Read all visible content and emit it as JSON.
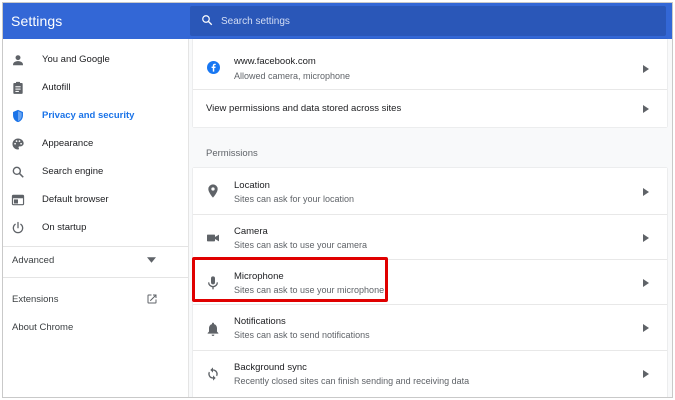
{
  "header": {
    "title": "Settings",
    "search_placeholder": "Search settings"
  },
  "sidebar": {
    "items": [
      {
        "label": "You and Google",
        "icon": "person-icon"
      },
      {
        "label": "Autofill",
        "icon": "clipboard-icon"
      },
      {
        "label": "Privacy and security",
        "icon": "shield-icon",
        "active": true
      },
      {
        "label": "Appearance",
        "icon": "palette-icon"
      },
      {
        "label": "Search engine",
        "icon": "search-icon"
      },
      {
        "label": "Default browser",
        "icon": "browser-icon"
      },
      {
        "label": "On startup",
        "icon": "power-icon"
      }
    ],
    "advanced_label": "Advanced",
    "extensions_label": "Extensions",
    "about_label": "About Chrome"
  },
  "main": {
    "site_row": {
      "title": "www.facebook.com",
      "subtitle": "Allowed camera, microphone",
      "icon": "facebook-icon"
    },
    "view_permissions_label": "View permissions and data stored across sites",
    "permissions_title": "Permissions",
    "permissions": [
      {
        "title": "Location",
        "subtitle": "Sites can ask for your location",
        "icon": "location-icon"
      },
      {
        "title": "Camera",
        "subtitle": "Sites can ask to use your camera",
        "icon": "camera-icon"
      },
      {
        "title": "Microphone",
        "subtitle": "Sites can ask to use your microphone",
        "icon": "microphone-icon"
      },
      {
        "title": "Notifications",
        "subtitle": "Sites can ask to send notifications",
        "icon": "bell-icon"
      },
      {
        "title": "Background sync",
        "subtitle": "Recently closed sites can finish sending and receiving data",
        "icon": "sync-icon"
      }
    ]
  },
  "colors": {
    "header": "#3367d6",
    "accent": "#1a73e8",
    "highlight": "#e00000"
  }
}
